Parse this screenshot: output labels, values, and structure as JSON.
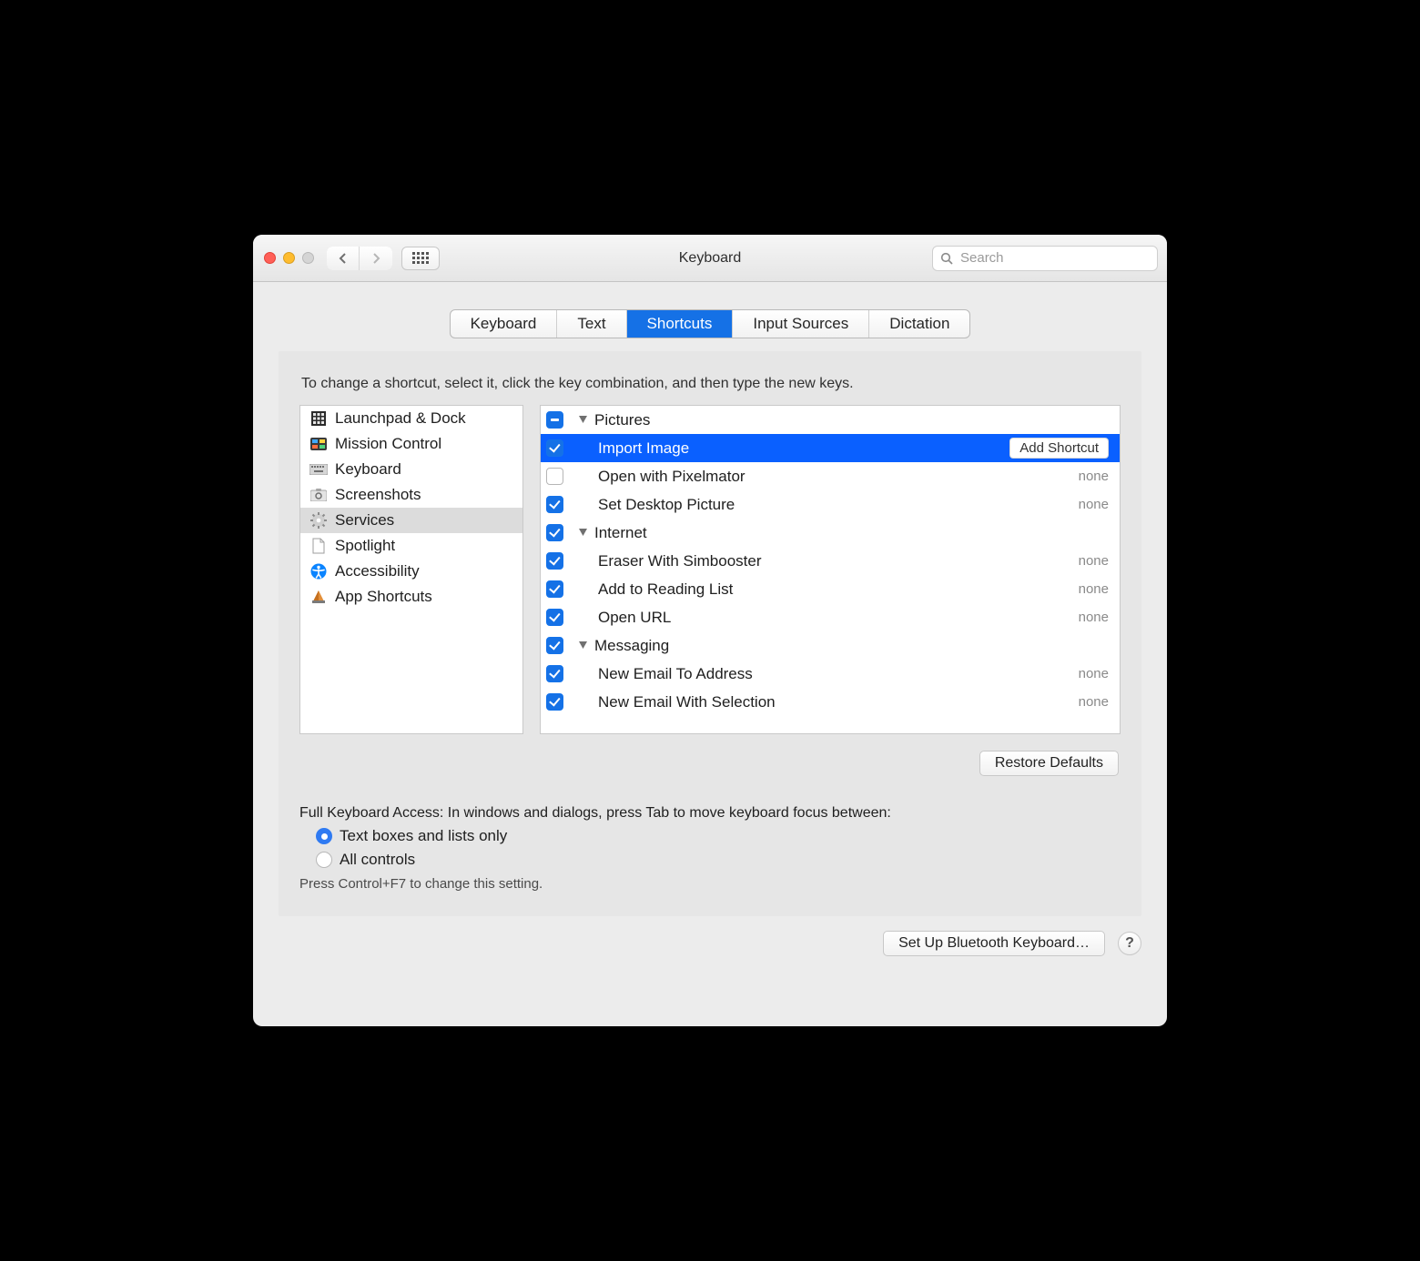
{
  "window": {
    "title": "Keyboard"
  },
  "toolbar": {
    "search_placeholder": "Search"
  },
  "tabs": [
    {
      "label": "Keyboard",
      "active": false
    },
    {
      "label": "Text",
      "active": false
    },
    {
      "label": "Shortcuts",
      "active": true
    },
    {
      "label": "Input Sources",
      "active": false
    },
    {
      "label": "Dictation",
      "active": false
    }
  ],
  "instructions": "To change a shortcut, select it, click the key combination, and then type the new keys.",
  "sidebar": {
    "items": [
      {
        "label": "Launchpad & Dock",
        "icon": "grid-icon"
      },
      {
        "label": "Mission Control",
        "icon": "mission-icon"
      },
      {
        "label": "Keyboard",
        "icon": "keyboard-icon"
      },
      {
        "label": "Screenshots",
        "icon": "screenshot-icon"
      },
      {
        "label": "Services",
        "icon": "gear-icon",
        "selected": true
      },
      {
        "label": "Spotlight",
        "icon": "document-icon"
      },
      {
        "label": "Accessibility",
        "icon": "accessibility-icon"
      },
      {
        "label": "App Shortcuts",
        "icon": "app-icon"
      }
    ]
  },
  "services": {
    "rows": [
      {
        "type": "group",
        "check": "partial",
        "label": "Pictures"
      },
      {
        "type": "item",
        "check": "checked",
        "label": "Import Image",
        "shortcut": "",
        "selected": true,
        "add_button": "Add Shortcut"
      },
      {
        "type": "item",
        "check": "unchecked",
        "label": "Open with Pixelmator",
        "shortcut": "none"
      },
      {
        "type": "item",
        "check": "checked",
        "label": "Set Desktop Picture",
        "shortcut": "none"
      },
      {
        "type": "group",
        "check": "checked",
        "label": "Internet"
      },
      {
        "type": "item",
        "check": "checked",
        "label": "Eraser With Simbooster",
        "shortcut": "none"
      },
      {
        "type": "item",
        "check": "checked",
        "label": "Add to Reading List",
        "shortcut": "none"
      },
      {
        "type": "item",
        "check": "checked",
        "label": "Open URL",
        "shortcut": "none"
      },
      {
        "type": "group",
        "check": "checked",
        "label": "Messaging"
      },
      {
        "type": "item",
        "check": "checked",
        "label": "New Email To Address",
        "shortcut": "none"
      },
      {
        "type": "item",
        "check": "checked",
        "label": "New Email With Selection",
        "shortcut": "none"
      }
    ]
  },
  "buttons": {
    "restore_defaults": "Restore Defaults",
    "setup_bluetooth": "Set Up Bluetooth Keyboard…"
  },
  "fka": {
    "heading": "Full Keyboard Access: In windows and dialogs, press Tab to move keyboard focus between:",
    "option1": "Text boxes and lists only",
    "option2": "All controls",
    "hint": "Press Control+F7 to change this setting."
  }
}
